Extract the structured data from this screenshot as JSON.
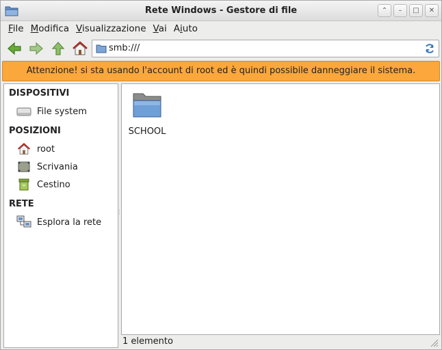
{
  "window": {
    "title": "Rete Windows - Gestore di file"
  },
  "menu": [
    {
      "mnemonic": "F",
      "rest": "ile"
    },
    {
      "mnemonic": "M",
      "rest": "odifica"
    },
    {
      "mnemonic": "V",
      "rest": "isualizzazione"
    },
    {
      "mnemonic": "V",
      "rest": "ai"
    },
    {
      "pre": "A",
      "mnemonic": "i",
      "rest": "uto"
    }
  ],
  "location": {
    "path": "smb:///"
  },
  "warning": {
    "text": "Attenzione! si sta usando l'account di root ed è quindi possibile danneggiare il sistema."
  },
  "sidebar": {
    "sections": [
      {
        "title": "DISPOSITIVI",
        "items": [
          {
            "label": "File system",
            "icon": "drive-icon"
          }
        ]
      },
      {
        "title": "POSIZIONI",
        "items": [
          {
            "label": "root",
            "icon": "home-icon"
          },
          {
            "label": "Scrivania",
            "icon": "desktop-icon"
          },
          {
            "label": "Cestino",
            "icon": "trash-icon"
          }
        ]
      },
      {
        "title": "RETE",
        "items": [
          {
            "label": "Esplora la rete",
            "icon": "network-icon"
          }
        ]
      }
    ]
  },
  "files": [
    {
      "name": "SCHOOL",
      "icon": "folder-icon"
    }
  ],
  "status": {
    "text": "1 elemento"
  },
  "colors": {
    "warning_bg": "#fba73b",
    "accent_green": "#5d9b2f"
  }
}
